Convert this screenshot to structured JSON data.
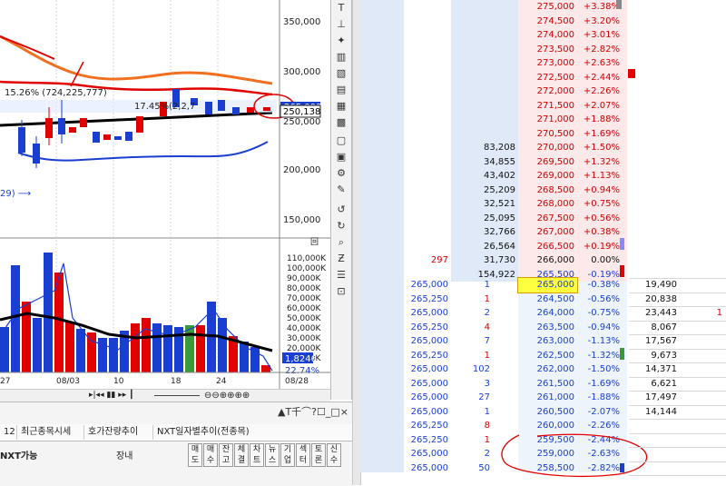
{
  "chart": {
    "price_ticks": [
      "350,000",
      "300,000",
      "250,000",
      "200,000",
      "150,000"
    ],
    "volume_ticks": [
      "110,000K",
      "100,000K",
      "90,000K",
      "80,000K",
      "70,000K",
      "60,000K",
      "50,000K",
      "40,000K",
      "30,000K",
      "20,000K",
      "10,000K"
    ],
    "date_ticks": [
      "27",
      "08/03",
      "10",
      "18",
      "24",
      "08/28"
    ],
    "annot_high": "15.26% (724,225,777)",
    "annot_mid": "17.45%",
    "annot_mid_rest": "(2,2,7",
    "current_price": "250,138",
    "price_tag": "265,000",
    "annot_left": "29) ⟶",
    "vol_value": "1,8246",
    "vol_pct": "22.74%",
    "vol_markers": "回"
  },
  "bottom": {
    "win_controls": "▲T千⌒?☐_□×",
    "tabs": [
      "12",
      "최근종목시세",
      "호가잔량추이",
      "NXT일자별추이(전종목)"
    ],
    "nxt_label": "NXT가능",
    "market": "장내",
    "side_buttons": [
      "매도",
      "매수",
      "잔고",
      "체결",
      "차트",
      "뉴스",
      "기업",
      "섹터",
      "토론",
      "신수"
    ]
  },
  "orderbook": {
    "ask_rows": [
      {
        "vol": "",
        "price": "275,000",
        "pct": "+3.38%"
      },
      {
        "vol": "",
        "price": "274,500",
        "pct": "+3.20%"
      },
      {
        "vol": "",
        "price": "274,000",
        "pct": "+3.01%"
      },
      {
        "vol": "",
        "price": "273,500",
        "pct": "+2.82%"
      },
      {
        "vol": "",
        "price": "273,000",
        "pct": "+2.63%"
      },
      {
        "vol": "",
        "price": "272,500",
        "pct": "+2.44%"
      },
      {
        "vol": "",
        "price": "272,000",
        "pct": "+2.26%"
      },
      {
        "vol": "",
        "price": "271,500",
        "pct": "+2.07%"
      },
      {
        "vol": "",
        "price": "271,000",
        "pct": "+1.88%"
      },
      {
        "vol": "",
        "price": "270,500",
        "pct": "+1.69%"
      },
      {
        "vol": "83,208",
        "price": "270,000",
        "pct": "+1.50%"
      },
      {
        "vol": "34,855",
        "price": "269,500",
        "pct": "+1.32%"
      },
      {
        "vol": "43,402",
        "price": "269,000",
        "pct": "+1.13%"
      },
      {
        "vol": "25,209",
        "price": "268,500",
        "pct": "+0.94%"
      },
      {
        "vol": "32,521",
        "price": "268,000",
        "pct": "+0.75%"
      },
      {
        "vol": "25,095",
        "price": "267,500",
        "pct": "+0.56%"
      },
      {
        "vol": "32,766",
        "price": "267,000",
        "pct": "+0.38%"
      },
      {
        "vol": "26,564",
        "price": "266,500",
        "pct": "+0.19%"
      },
      {
        "vol": "31,730",
        "price": "266,000",
        "pct": "0.00%",
        "left": "297"
      },
      {
        "vol": "154,922",
        "price": "265,500",
        "pct": "-0.19%"
      }
    ],
    "bid_rows": [
      {
        "p": "265,000",
        "q": "1",
        "price": "265,000",
        "pct": "-0.38%",
        "vol": "19,490",
        "hl": true
      },
      {
        "p": "265,250",
        "q": "1",
        "price": "264,500",
        "pct": "-0.56%",
        "vol": "20,838"
      },
      {
        "p": "265,000",
        "q": "2",
        "price": "264,000",
        "pct": "-0.75%",
        "vol": "23,443",
        "extra": "1"
      },
      {
        "p": "265,250",
        "q": "4",
        "price": "263,500",
        "pct": "-0.94%",
        "vol": "8,067"
      },
      {
        "p": "265,000",
        "q": "7",
        "price": "263,000",
        "pct": "-1.13%",
        "vol": "17,567"
      },
      {
        "p": "265,250",
        "q": "1",
        "price": "262,500",
        "pct": "-1.32%",
        "vol": "9,673"
      },
      {
        "p": "265,000",
        "q": "102",
        "price": "262,000",
        "pct": "-1.50%",
        "vol": "14,371"
      },
      {
        "p": "265,000",
        "q": "3",
        "price": "261,500",
        "pct": "-1.69%",
        "vol": "6,621"
      },
      {
        "p": "265,000",
        "q": "27",
        "price": "261,000",
        "pct": "-1.88%",
        "vol": "17,497"
      },
      {
        "p": "265,000",
        "q": "1",
        "price": "260,500",
        "pct": "-2.07%",
        "vol": "14,144"
      },
      {
        "p": "265,250",
        "q": "8",
        "price": "260,000",
        "pct": "-2.26%",
        "vol": ""
      },
      {
        "p": "265,250",
        "q": "1",
        "price": "259,500",
        "pct": "-2.44%",
        "vol": ""
      },
      {
        "p": "265,000",
        "q": "2",
        "price": "259,000",
        "pct": "-2.63%",
        "vol": ""
      },
      {
        "p": "265,000",
        "q": "50",
        "price": "258,500",
        "pct": "-2.82%",
        "vol": ""
      }
    ]
  }
}
